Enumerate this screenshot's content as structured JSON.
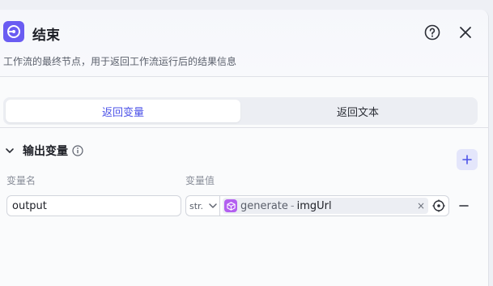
{
  "node": {
    "title": "结束",
    "description": "工作流的最终节点，用于返回工作流运行后的结果信息",
    "icon": "end-node-icon",
    "accent": "#6a5cf2"
  },
  "header": {
    "help_icon": "question-circle-icon",
    "close_icon": "close-icon"
  },
  "tabs": [
    {
      "label": "返回变量",
      "active": true
    },
    {
      "label": "返回文本",
      "active": false
    }
  ],
  "output_section": {
    "title": "输出变量",
    "columns": {
      "name": "变量名",
      "value": "变量值"
    },
    "rows": [
      {
        "name": "output",
        "type": "str.",
        "ref_node": "generate",
        "ref_separator": "-",
        "ref_var": "imgUrl",
        "clear_label": "×"
      }
    ]
  }
}
